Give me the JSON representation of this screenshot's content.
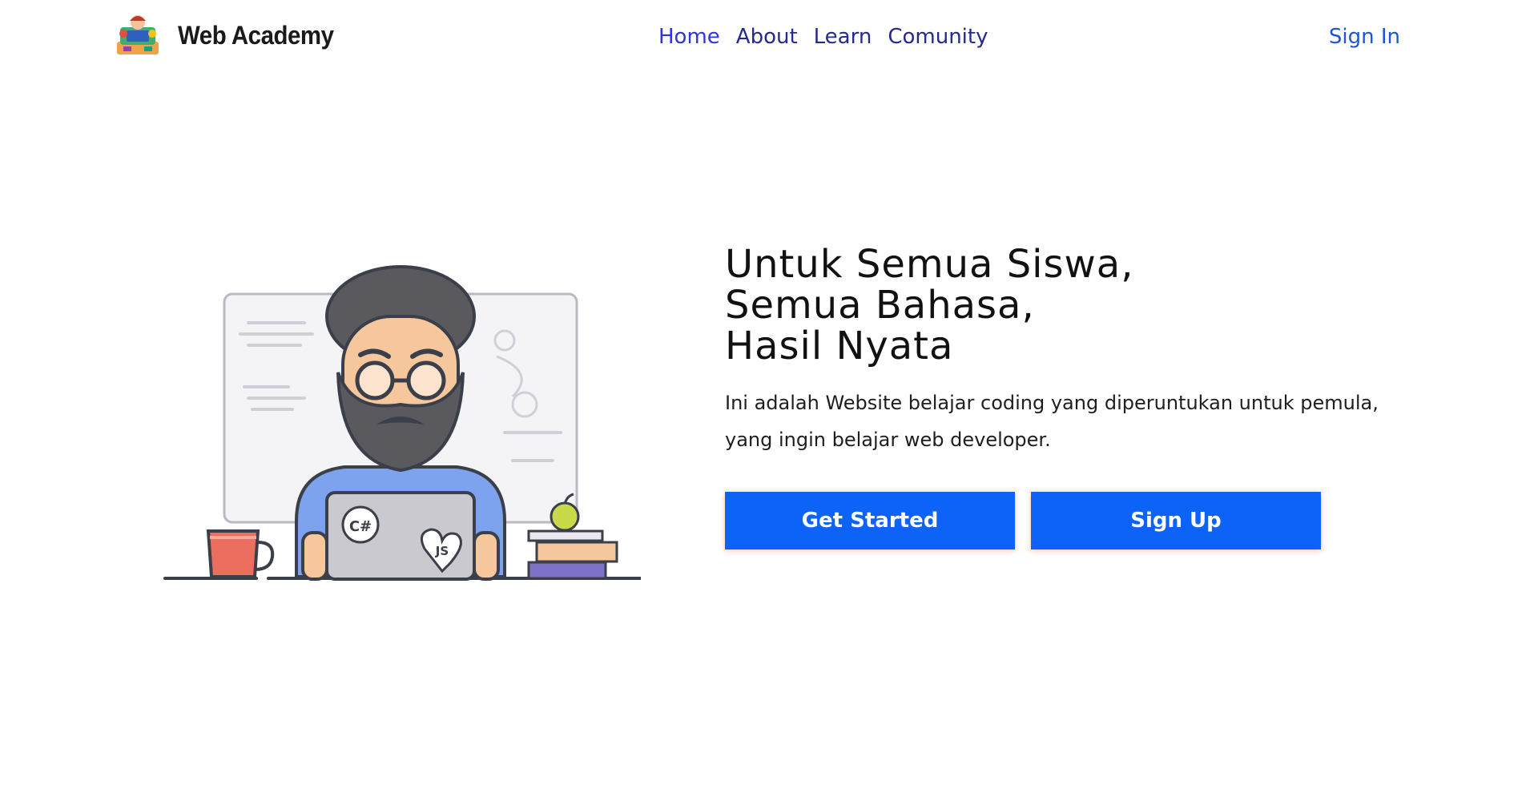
{
  "brand": {
    "name": "Web Academy",
    "logo_icon": "web-academy-logo-icon"
  },
  "nav": {
    "items": [
      {
        "label": "Home"
      },
      {
        "label": "About"
      },
      {
        "label": "Learn"
      },
      {
        "label": "Comunity"
      }
    ],
    "sign_in": "Sign In"
  },
  "hero": {
    "title_lines": [
      "Untuk Semua Siswa,",
      "Semua Bahasa,",
      "Hasil Nyata"
    ],
    "description": "Ini adalah Website belajar coding yang diperuntukan untuk pemula, yang ingin belajar web developer.",
    "buttons": {
      "get_started": "Get Started",
      "sign_up": "Sign Up"
    },
    "illustration": {
      "name": "programmer-with-laptop-illustration",
      "laptop_sticker_1": "C#",
      "laptop_sticker_2": "JS"
    }
  },
  "colors": {
    "accent_blue": "#0d62f8",
    "nav_link": "#2f35e0",
    "nav_link_dark": "#262a8c",
    "sign_in": "#1f56d6",
    "background": "#ffffff"
  }
}
